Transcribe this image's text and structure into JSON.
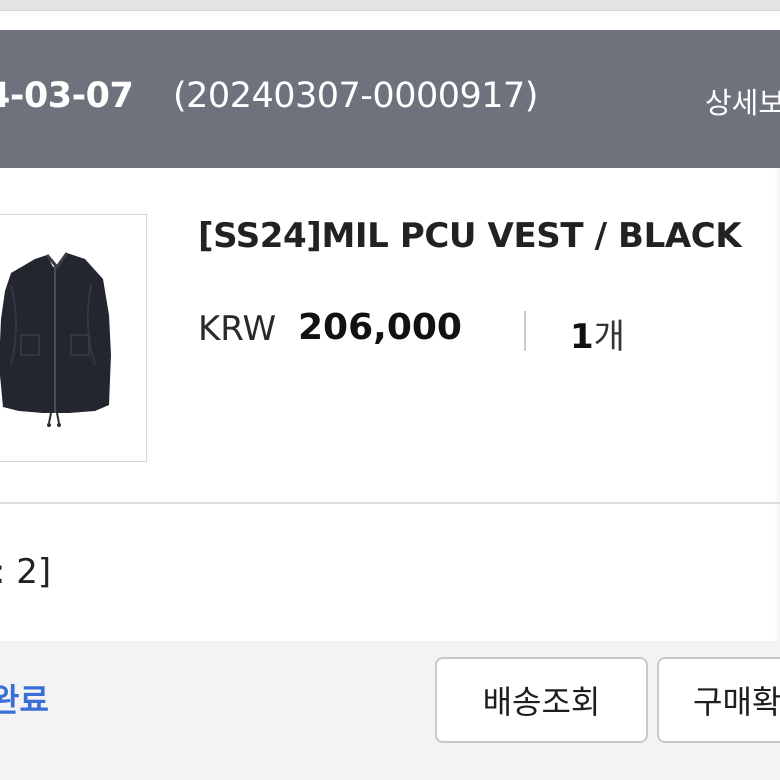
{
  "order": {
    "date": "4-03-07",
    "number": "(20240307-0000917)",
    "detail_label": "상세보"
  },
  "product": {
    "name": "[SS24]MIL PCU VEST / BLACK",
    "currency": "KRW",
    "price": "206,000",
    "quantity_number": "1",
    "quantity_unit": "개",
    "image_icon": "black-vest-image"
  },
  "option": {
    "text": ": 2]"
  },
  "status": {
    "text": "완료",
    "color": "#3b6fd8"
  },
  "actions": {
    "tracking_label": "배송조회",
    "confirm_label": "구매확"
  },
  "colors": {
    "header_bg": "#6d727c",
    "bottom_bar_bg": "#f3f3f3"
  }
}
